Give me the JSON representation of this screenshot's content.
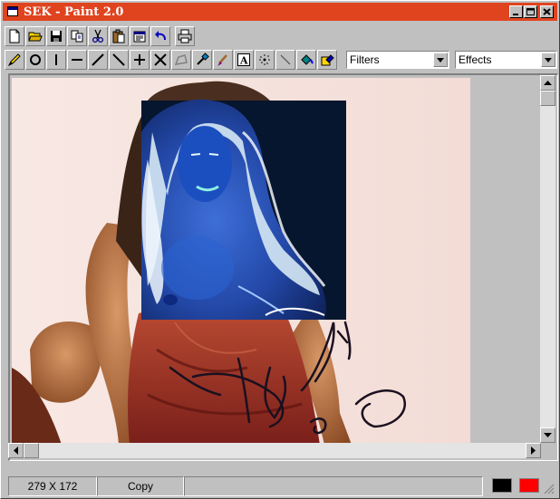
{
  "window": {
    "title": "SEK - Paint 2.0",
    "controls": {
      "minimize": "_",
      "maximize": "□",
      "close": "✕"
    }
  },
  "toolbar_main": [
    {
      "name": "new-file-icon"
    },
    {
      "name": "open-folder-icon"
    },
    {
      "name": "save-disk-icon"
    },
    {
      "name": "copy-icon"
    },
    {
      "name": "cut-scissors-icon"
    },
    {
      "name": "paste-clipboard-icon"
    },
    {
      "name": "properties-icon"
    },
    {
      "name": "undo-arrow-icon"
    },
    {
      "name": "print-icon"
    }
  ],
  "toolbar_tools": [
    {
      "name": "pencil-tool-icon"
    },
    {
      "name": "circle-tool-icon"
    },
    {
      "name": "vertical-line-tool-icon"
    },
    {
      "name": "horizontal-line-tool-icon"
    },
    {
      "name": "diagonal-line-tool-icon"
    },
    {
      "name": "back-diagonal-line-tool-icon"
    },
    {
      "name": "plus-tool-icon"
    },
    {
      "name": "x-cross-tool-icon"
    },
    {
      "name": "polygon-tool-icon"
    },
    {
      "name": "eyedropper-tool-icon"
    },
    {
      "name": "brush-tool-icon"
    },
    {
      "name": "text-tool-icon"
    },
    {
      "name": "spray-tool-icon"
    },
    {
      "name": "line-tool-icon"
    },
    {
      "name": "fill-bucket-tool-icon"
    },
    {
      "name": "fill-color-tool-icon"
    }
  ],
  "filters_combo": {
    "value": "Filters"
  },
  "effects_combo": {
    "value": "Effects"
  },
  "status": {
    "dimensions": "279 X 172",
    "mode": "Copy"
  },
  "colors": {
    "titlebar": "#e0441f",
    "primary": "#000000",
    "secondary": "#ff0000"
  },
  "canvas": {
    "photo_name": "photo-with-inverted-selection",
    "signature_name": "handwritten-signature"
  }
}
